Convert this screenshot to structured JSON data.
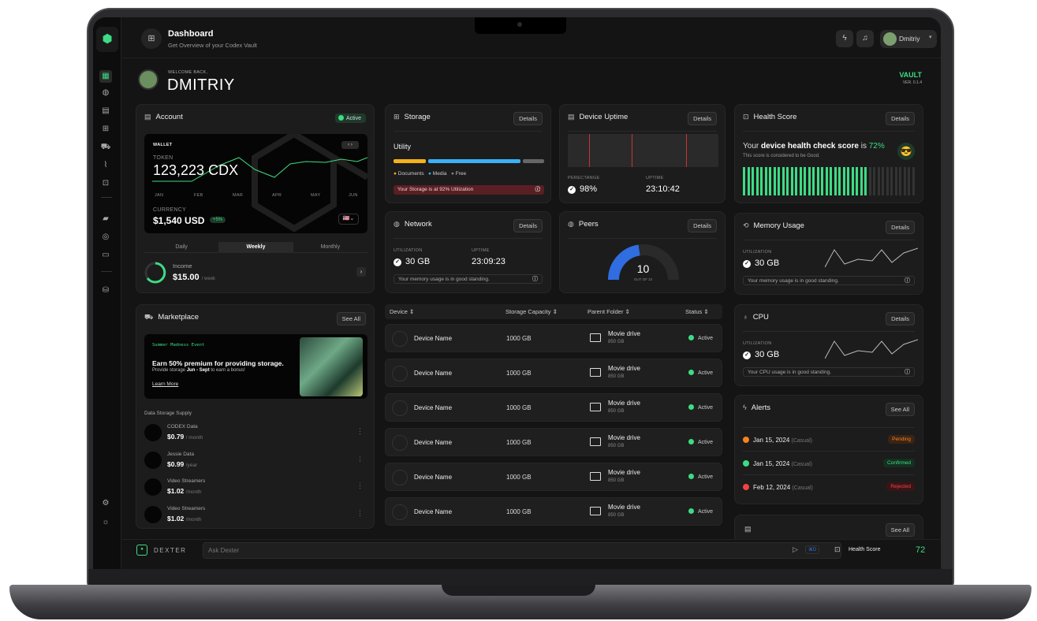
{
  "header": {
    "title": "Dashboard",
    "subtitle": "Get Overview of your Codex Vault",
    "user": "Dmitriy"
  },
  "welcome": {
    "small": "WELCOME BACK,",
    "name": "DMITRIY",
    "brand": "VAULT",
    "version": "VER. 0.1.4"
  },
  "account": {
    "title": "Account",
    "status": "Active",
    "wallet_label": "WALLET",
    "token_label": "TOKEN",
    "token_value": "123,223 CDX",
    "months": [
      "JAN",
      "FEB",
      "MAR",
      "APR",
      "MAY",
      "JUN"
    ],
    "currency_label": "CURRENCY",
    "currency_value": "$1,540 USD",
    "change": "+5%",
    "tabs": [
      "Daily",
      "Weekly",
      "Monthly"
    ],
    "active_tab": "Weekly",
    "income_label": "Income",
    "income_value": "$15.00",
    "income_period": "/ week"
  },
  "storage": {
    "title": "Storage",
    "button": "Details",
    "label": "Utility",
    "legend": [
      "Documents",
      "Media",
      "Free"
    ],
    "warning": "Your Storage is at 92% Utilization",
    "colors": {
      "documents": "#f5b11a",
      "media": "#3ab0f5",
      "free": "#666666"
    }
  },
  "uptime": {
    "title": "Device Uptime",
    "button": "Details",
    "pct_label": "PERECTANGE",
    "pct_value": "98%",
    "uptime_label": "UPTIME",
    "uptime_value": "23:10:42"
  },
  "health": {
    "title": "Health Score",
    "button": "Details",
    "text_a": "Your ",
    "text_b": "device health check score",
    "text_c": " is ",
    "score_text": "72%",
    "sub": "This score is considered to be Good.",
    "score": 72
  },
  "network": {
    "title": "Network",
    "button": "Details",
    "util_label": "UTILIZATION",
    "util_value": "30 GB",
    "uptime_label": "UPTIME",
    "uptime_value": "23:09:23",
    "note": "Your memory usage is in good standing."
  },
  "peers": {
    "title": "Peers",
    "button": "Details",
    "value": "10",
    "sub": "OUT OF 22",
    "fraction": 0.4545
  },
  "memory": {
    "title": "Memory Usage",
    "button": "Details",
    "util_label": "UTILIZATION",
    "util_value": "30 GB",
    "note": "Your memory usage is in good standing."
  },
  "cpu": {
    "title": "CPU",
    "button": "Details",
    "util_label": "UTILIZATION",
    "util_value": "30 GB",
    "note": "Your CPU usage is in good standing."
  },
  "marketplace": {
    "title": "Marketplace",
    "button": "See All",
    "promo_tag": "Summer Madness Event",
    "promo_title": "Earn 50% premium for providing storage.",
    "promo_sub_a": "Provide storage ",
    "promo_sub_b": "Jun - Sept",
    "promo_sub_c": " to earn a bonus!",
    "promo_link": "Learn More",
    "supply_label": "Data Storage Supply",
    "items": [
      {
        "name": "CODEX Data",
        "price": "$0.79",
        "unit": "/ month"
      },
      {
        "name": "Jessie Data",
        "price": "$0.99",
        "unit": "/year"
      },
      {
        "name": "Video Streamers",
        "price": "$1.02",
        "unit": "/month"
      },
      {
        "name": "Video Streamers",
        "price": "$1.02",
        "unit": "/month"
      }
    ]
  },
  "devices": {
    "headers": [
      "Device",
      "Storage Capacity",
      "Parent Folder",
      "Status"
    ],
    "rows": [
      {
        "name": "Device Name",
        "capacity": "1000 GB",
        "folder": "Movie drive",
        "folder_size": "850 GB",
        "status": "Active"
      },
      {
        "name": "Device Name",
        "capacity": "1000 GB",
        "folder": "Movie drive",
        "folder_size": "850 GB",
        "status": "Active"
      },
      {
        "name": "Device Name",
        "capacity": "1000 GB",
        "folder": "Movie drive",
        "folder_size": "850 GB",
        "status": "Active"
      },
      {
        "name": "Device Name",
        "capacity": "1000 GB",
        "folder": "Movie drive",
        "folder_size": "850 GB",
        "status": "Active"
      },
      {
        "name": "Device Name",
        "capacity": "1000 GB",
        "folder": "Movie drive",
        "folder_size": "850 GB",
        "status": "Active"
      },
      {
        "name": "Device Name",
        "capacity": "1000 GB",
        "folder": "Movie drive",
        "folder_size": "850 GB",
        "status": "Active"
      }
    ]
  },
  "alerts": {
    "title": "Alerts",
    "button": "See All",
    "rows": [
      {
        "date": "Jan 15, 2024",
        "tag": "(Casual)",
        "status": "Pending",
        "color": "#f5821f"
      },
      {
        "date": "Jan 15, 2024",
        "tag": "(Casual)",
        "status": "Confirmed",
        "color": "#3ddc84"
      },
      {
        "date": "Feb 12, 2024",
        "tag": "(Casual)",
        "status": "Rejected",
        "color": "#f04444"
      }
    ]
  },
  "extra_card": {
    "button": "See All"
  },
  "footer": {
    "brand": "DEXTER",
    "placeholder": "Ask Dexter",
    "shortcut": "⌘D",
    "health_label": "Health Score",
    "health_value": "72"
  },
  "accent": "#3ddc84"
}
